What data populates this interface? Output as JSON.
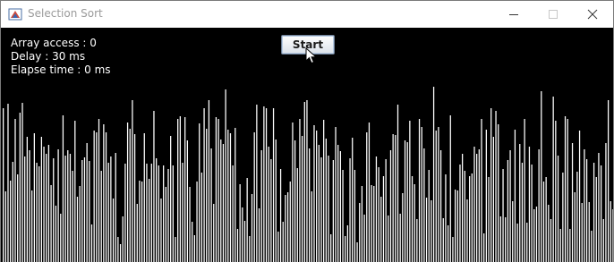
{
  "window": {
    "title": "Selection Sort",
    "icon": "java-app-icon",
    "controls": [
      "minimize-icon",
      "maximize-icon",
      "close-icon"
    ]
  },
  "stats": {
    "array_access": "Array access : 0",
    "delay": "Delay : 30 ms",
    "elapsed": "Elapse time : 0 ms"
  },
  "controls": {
    "start_label": "Start"
  },
  "bars": {
    "color": "#ffffff",
    "background": "#000000",
    "max_value": 196,
    "values": [
      172,
      79,
      177,
      91,
      112,
      160,
      98,
      167,
      178,
      118,
      140,
      125,
      80,
      144,
      111,
      107,
      140,
      129,
      121,
      131,
      86,
      116,
      63,
      126,
      54,
      164,
      119,
      125,
      121,
      102,
      158,
      73,
      85,
      114,
      117,
      133,
      113,
      42,
      147,
      145,
      160,
      102,
      154,
      145,
      111,
      118,
      71,
      122,
      28,
      20,
      51,
      110,
      156,
      149,
      181,
      143,
      65,
      91,
      90,
      144,
      110,
      93,
      110,
      169,
      116,
      108,
      71,
      108,
      84,
      104,
      141,
      108,
      28,
      160,
      163,
      111,
      162,
      136,
      84,
      45,
      30,
      90,
      155,
      100,
      172,
      149,
      181,
      127,
      65,
      162,
      160,
      137,
      132,
      193,
      148,
      144,
      108,
      150,
      37,
      87,
      61,
      46,
      94,
      29,
      76,
      145,
      176,
      60,
      125,
      174,
      172,
      129,
      115,
      172,
      137,
      34,
      104,
      45,
      75,
      78,
      90,
      156,
      136,
      105,
      160,
      141,
      179,
      181,
      127,
      79,
      153,
      147,
      131,
      117,
      159,
      138,
      119,
      31,
      114,
      151,
      131,
      124,
      103,
      29,
      41,
      116,
      139,
      103,
      22,
      66,
      85,
      53,
      145,
      156,
      86,
      85,
      118,
      106,
      73,
      96,
      115,
      52,
      125,
      143,
      142,
      176,
      54,
      77,
      136,
      134,
      158,
      96,
      87,
      48,
      160,
      151,
      127,
      72,
      103,
      69,
      196,
      147,
      151,
      125,
      49,
      98,
      41,
      164,
      28,
      81,
      80,
      109,
      121,
      102,
      70,
      96,
      99,
      129,
      121,
      126,
      160,
      32,
      148,
      95,
      172,
      140,
      169,
      154,
      51,
      104,
      50,
      114,
      125,
      68,
      148,
      43,
      132,
      111,
      160,
      44,
      129,
      109,
      59,
      62,
      126,
      191,
      90,
      95,
      64,
      48,
      185,
      158,
      119,
      37,
      100,
      163,
      160,
      37,
      133,
      78,
      101,
      147,
      66,
      126,
      115,
      67,
      35,
      111,
      95,
      122,
      108,
      48,
      133,
      181,
      68,
      59
    ]
  }
}
